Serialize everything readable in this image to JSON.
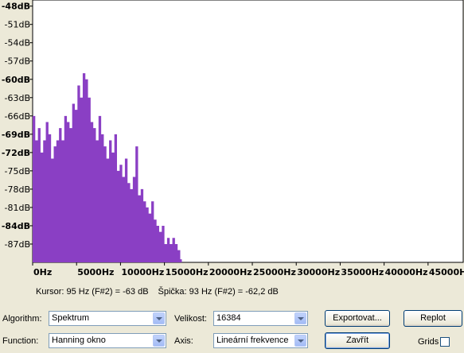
{
  "chart_data": {
    "type": "bar",
    "y_ticks": [
      "-48dB",
      "-51dB",
      "-54dB",
      "-57dB",
      "-60dB",
      "-63dB",
      "-66dB",
      "-69dB",
      "-72dB",
      "-75dB",
      "-78dB",
      "-81dB",
      "-84dB",
      "-87dB"
    ],
    "y_bold": [
      true,
      false,
      false,
      false,
      true,
      false,
      false,
      true,
      true,
      false,
      false,
      false,
      true,
      false
    ],
    "x_ticks": [
      "0Hz",
      "5000Hz",
      "10000Hz",
      "15000Hz",
      "20000Hz",
      "25000Hz",
      "30000Hz",
      "35000Hz",
      "40000Hz",
      "45000Hz"
    ],
    "x_tick_values": [
      0,
      5000,
      10000,
      15000,
      20000,
      25000,
      30000,
      35000,
      40000,
      45000
    ],
    "xlim": [
      0,
      49000
    ],
    "ylim": [
      -90,
      -47
    ],
    "fill_color": "#8a3fc4",
    "spectrum": {
      "x": [
        0,
        300,
        600,
        900,
        1200,
        1500,
        1800,
        2100,
        2400,
        2700,
        3000,
        3300,
        3600,
        3900,
        4200,
        4500,
        4800,
        5100,
        5400,
        5700,
        6000,
        6300,
        6600,
        6900,
        7200,
        7500,
        7800,
        8100,
        8400,
        8700,
        9000,
        9300,
        9600,
        9900,
        10200,
        10500,
        10800,
        11100,
        11400,
        11700,
        12000,
        12300,
        12600,
        12900,
        13200,
        13500,
        13800,
        14100,
        14400,
        14700,
        15000,
        15300,
        15600,
        15900,
        16200,
        16500,
        16800
      ],
      "y": [
        -66,
        -70,
        -68,
        -72,
        -70,
        -67,
        -69,
        -73,
        -71,
        -70,
        -68,
        -70,
        -66,
        -67,
        -68,
        -64,
        -65,
        -61,
        -63,
        -59,
        -60,
        -63,
        -67,
        -68,
        -70,
        -66,
        -69,
        -71,
        -73,
        -70,
        -72,
        -69,
        -75,
        -74,
        -76,
        -73,
        -77,
        -78,
        -76,
        -71,
        -79,
        -78,
        -80,
        -81,
        -82,
        -80,
        -83,
        -84,
        -85,
        -84,
        -87,
        -86,
        -87,
        -86,
        -87,
        -88,
        -89.5
      ]
    }
  },
  "status": {
    "cursor": "Kursor: 95 Hz (F#2) = -63 dB",
    "peak": "Špička: 93 Hz (F#2) = -62,2 dB"
  },
  "controls": {
    "algorithm_label": "Algorithm:",
    "algorithm_value": "Spektrum",
    "function_label": "Function:",
    "function_value": "Hanning okno",
    "size_label": "Velikost:",
    "size_value": "16384",
    "axis_label": "Axis:",
    "axis_value": "Lineární frekvence",
    "export_label": "Exportovat...",
    "close_label": "Zavřít",
    "replot_label": "Replot",
    "grids_label": "Grids"
  }
}
